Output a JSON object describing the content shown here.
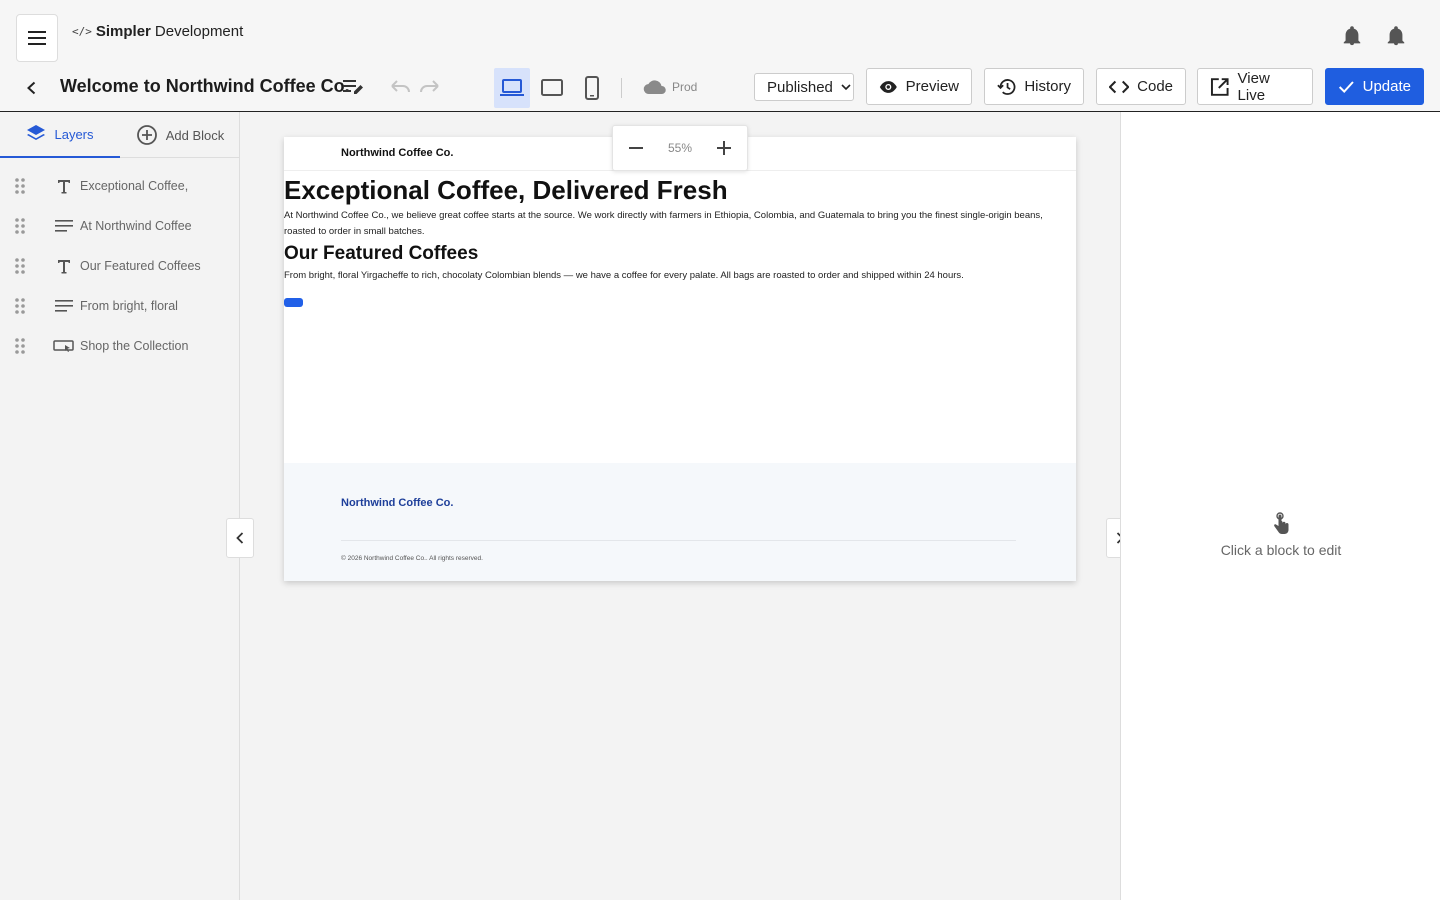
{
  "header": {
    "brand_tag": "</>",
    "brand_bold": "Simpler",
    "brand_rest": "Development",
    "page_title": "Welcome to Northwind Coffee Co.",
    "environment": "Prod",
    "status_value": "Published",
    "buttons": {
      "preview": "Preview",
      "history": "History",
      "code": "Code",
      "view_live": "View Live",
      "update": "Update"
    }
  },
  "left_panel": {
    "tabs": {
      "layers": "Layers",
      "add_block": "Add Block"
    },
    "layers": [
      {
        "type": "heading",
        "label": "Exceptional Coffee,"
      },
      {
        "type": "paragraph",
        "label": "At Northwind Coffee"
      },
      {
        "type": "heading",
        "label": "Our Featured Coffees"
      },
      {
        "type": "paragraph",
        "label": "From bright, floral"
      },
      {
        "type": "button",
        "label": "Shop the Collection"
      }
    ]
  },
  "canvas": {
    "zoom": "55%",
    "site": {
      "logo": "Northwind Coffee Co.",
      "hero_heading": "Exceptional Coffee, Delivered Fresh",
      "hero_text": "At Northwind Coffee Co., we believe great coffee starts at the source. We work directly with farmers in Ethiopia, Colombia, and Guatemala to bring you the finest single-origin beans, roasted to order in small batches.",
      "featured_heading": "Our Featured Coffees",
      "featured_text": "From bright, floral Yirgacheffe to rich, chocolaty Colombian blends — we have a coffee for every palate. All bags are roasted to order and shipped within 24 hours.",
      "footer_brand": "Northwind Coffee Co.",
      "footer_copy": "© 2026 Northwind Coffee Co.. All rights reserved."
    }
  },
  "right_panel": {
    "hint": "Click a block to edit"
  },
  "colors": {
    "accent": "#1f5ee0",
    "active_tab": "#2559d6",
    "footer_brand": "#1e3f9a"
  }
}
